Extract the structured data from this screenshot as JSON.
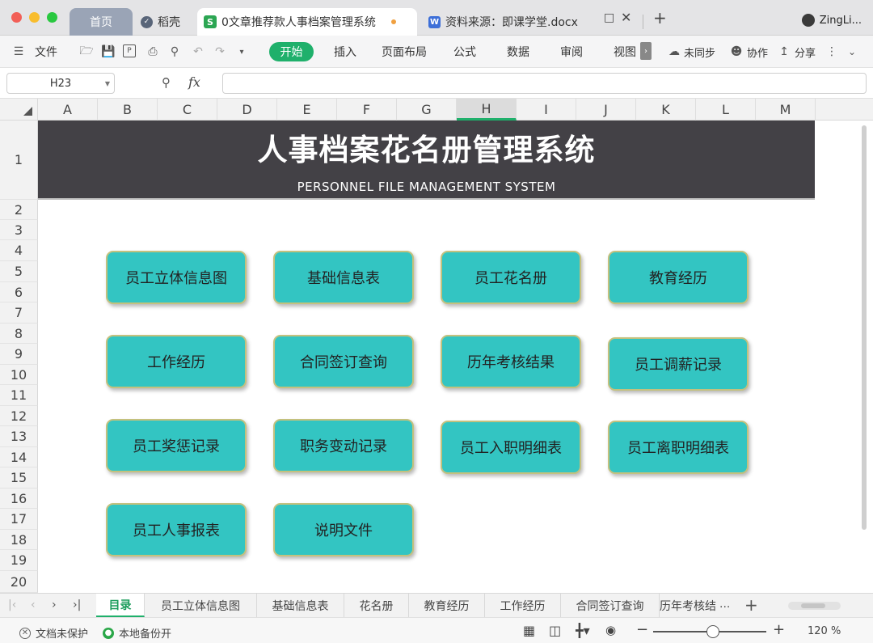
{
  "window": {
    "tabs": [
      {
        "label": "首页"
      },
      {
        "label": "稻壳",
        "icon": "daoke-icon"
      },
      {
        "label": "0文章推荐款人事档案管理系统",
        "icon": "spreadsheet-s-icon"
      },
      {
        "label": "资料来源：即课学堂.docx",
        "icon": "word-w-icon"
      }
    ],
    "user": "ZingLi..."
  },
  "menubar": {
    "file": "文件",
    "tabs": [
      "开始",
      "插入",
      "页面布局",
      "公式",
      "数据",
      "审阅",
      "视图"
    ],
    "sync": "未同步",
    "collab": "协作",
    "share": "分享"
  },
  "formula": {
    "name_box": "H23",
    "fx": "fx",
    "value": ""
  },
  "grid": {
    "columns": [
      "A",
      "B",
      "C",
      "D",
      "E",
      "F",
      "G",
      "H",
      "I",
      "J",
      "K",
      "L",
      "M"
    ],
    "selected_column": "H",
    "rows": [
      "1",
      "2",
      "3",
      "4",
      "5",
      "6",
      "7",
      "8",
      "9",
      "10",
      "11",
      "12",
      "13",
      "14",
      "15",
      "16",
      "17",
      "18",
      "19",
      "20"
    ]
  },
  "banner": {
    "title": "人事档案花名册管理系统",
    "subtitle": "PERSONNEL FILE MANAGEMENT SYSTEM"
  },
  "nav_buttons": [
    "员工立体信息图",
    "基础信息表",
    "员工花名册",
    "教育经历",
    "工作经历",
    "合同签订查询",
    "历年考核结果",
    "员工调薪记录",
    "员工奖惩记录",
    "职务变动记录",
    "员工入职明细表",
    "员工离职明细表",
    "员工人事报表",
    "说明文件"
  ],
  "sheet_tabs": [
    "目录",
    "员工立体信息图",
    "基础信息表",
    "花名册",
    "教育经历",
    "工作经历",
    "合同签订查询",
    "历年考核结",
    "..."
  ],
  "active_sheet": "目录",
  "status": {
    "protect": "文档未保护",
    "backup": "本地备份开",
    "zoom": "120 %"
  },
  "colors": {
    "accent": "#1fb06b",
    "banner_bg": "#434146",
    "button_bg": "#33c5c2",
    "button_border": "#c4c17e"
  }
}
